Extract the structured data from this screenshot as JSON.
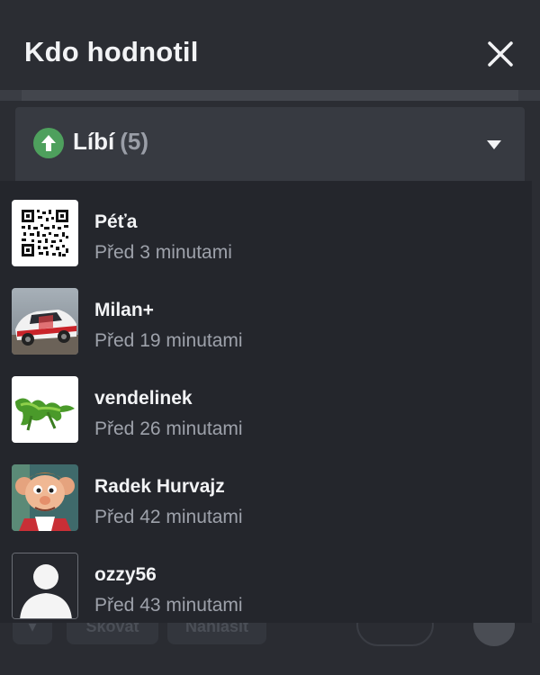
{
  "modal": {
    "title": "Kdo hodnotil",
    "close_icon": "close-icon"
  },
  "dropdown": {
    "icon": "arrow-up-circle-icon",
    "label": "Líbí",
    "count": "(5)",
    "caret_icon": "caret-down-icon"
  },
  "voters": [
    {
      "name": "Péťa",
      "time": "Před 3 minutami",
      "avatar": "qr-code-avatar"
    },
    {
      "name": "Milan+",
      "time": "Před 19 minutami",
      "avatar": "rally-car-avatar"
    },
    {
      "name": "vendelinek",
      "time": "Před 26 minutami",
      "avatar": "green-lizard-avatar"
    },
    {
      "name": "Radek Hurvajz",
      "time": "Před 42 minutami",
      "avatar": "puppet-avatar"
    },
    {
      "name": "ozzy56",
      "time": "Před 43 minutami",
      "avatar": "default-person-avatar"
    }
  ],
  "background": {
    "buttons": [
      "Skóvat",
      "Nahlásit"
    ],
    "vote_count": "5"
  },
  "colors": {
    "accent_green": "#4ea05d",
    "panel": "#2b2d33",
    "list_bg": "#24262c"
  }
}
